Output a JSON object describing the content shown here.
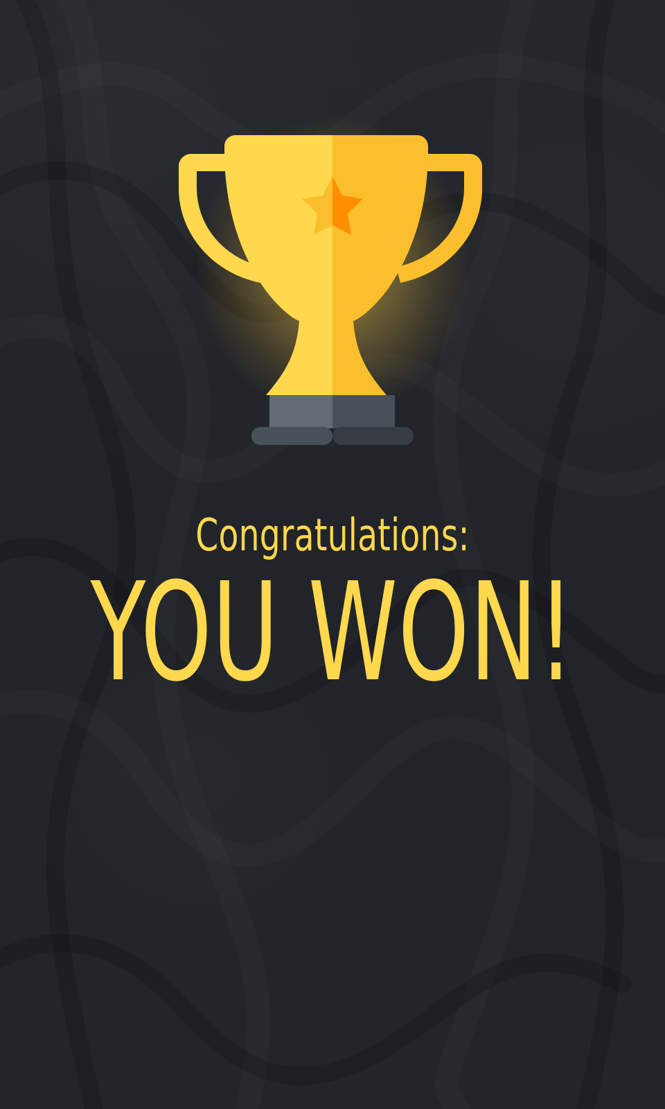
{
  "screen": {
    "title": "Congratulations:",
    "headline": "YOU WON!",
    "trophy_icon": "trophy-icon",
    "star_icon": "star-icon",
    "accent_color": "#ffd84d",
    "background_color": "#23262b",
    "trophy_gold_light": "#ffd84d",
    "trophy_gold_dark": "#fbbf2d",
    "trophy_base_light": "#636b75",
    "trophy_base_dark": "#48505a"
  }
}
